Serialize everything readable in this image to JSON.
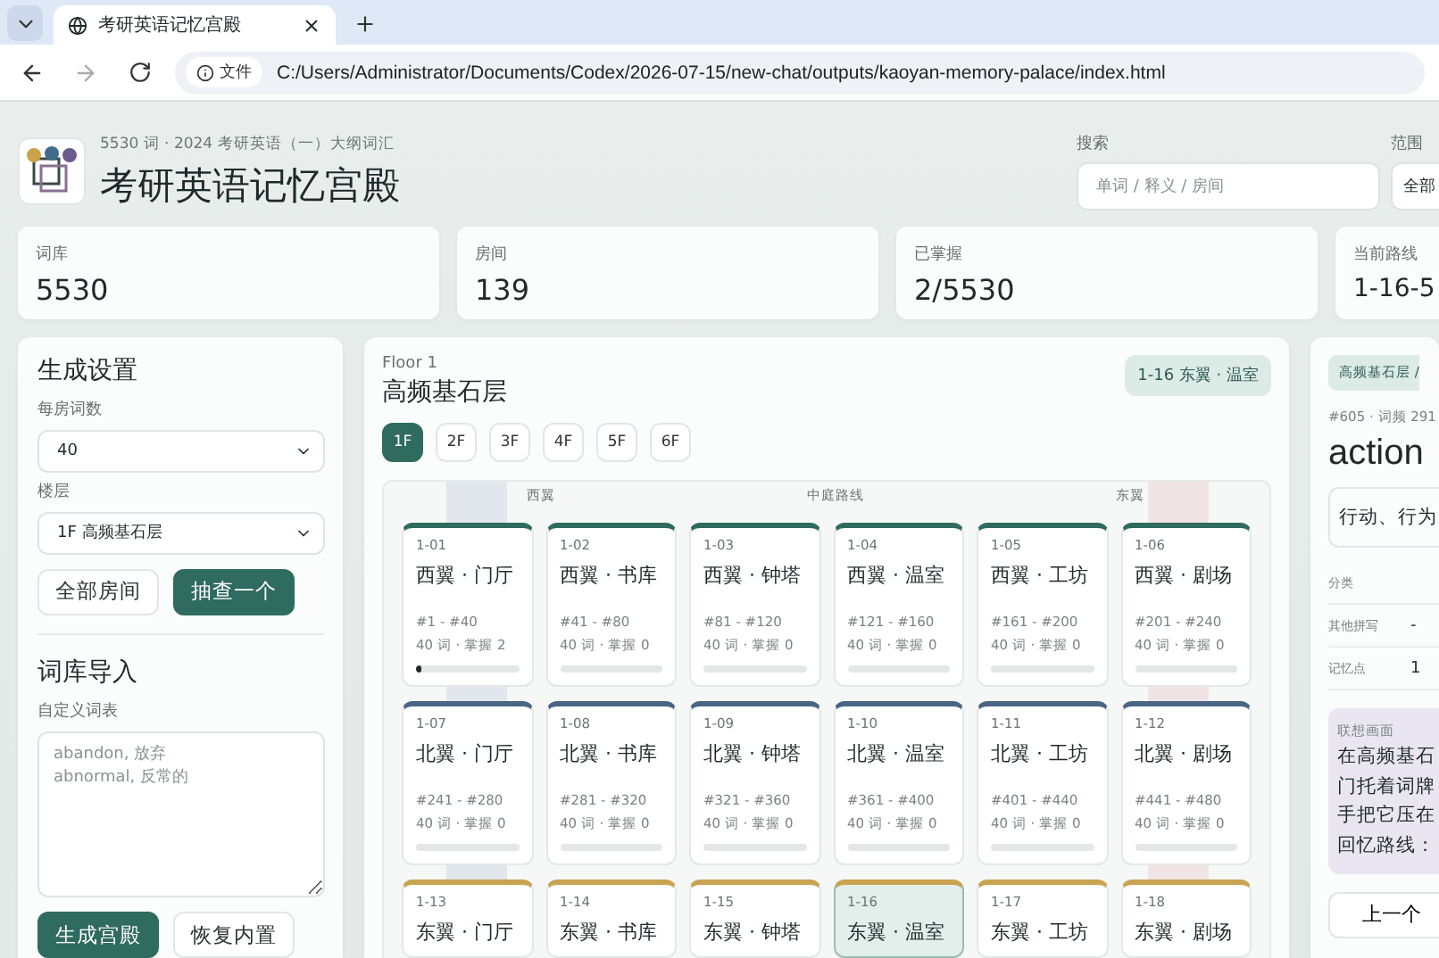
{
  "browser": {
    "tab_title": "考研英语记忆宫殿",
    "address_label": "文件",
    "url": "C:/Users/Administrator/Documents/Codex/2026-07-15/new-chat/outputs/kaoyan-memory-palace/index.html"
  },
  "header": {
    "subtitle": "5530 词 · 2024 考研英语（一）大纲词汇",
    "title": "考研英语记忆宫殿",
    "search": {
      "label": "搜索",
      "placeholder": "单词 / 释义 / 房间"
    },
    "scope": {
      "label": "范围",
      "value": "全部"
    }
  },
  "stats": [
    {
      "label": "词库",
      "value": "5530"
    },
    {
      "label": "房间",
      "value": "139"
    },
    {
      "label": "已掌握",
      "value": "2/5530"
    },
    {
      "label": "当前路线",
      "value": "1-16-5"
    }
  ],
  "settings": {
    "title": "生成设置",
    "per_room": {
      "label": "每房词数",
      "value": "40"
    },
    "floor_select": {
      "label": "楼层",
      "value": "1F 高频基石层"
    },
    "buttons": [
      {
        "label": "全部房间",
        "primary": false
      },
      {
        "label": "抽查一个",
        "primary": true
      }
    ],
    "import_title": "词库导入",
    "import_label": "自定义词表",
    "import_placeholder": "abandon, 放弃\nabnormal, 反常的",
    "import_buttons": [
      {
        "label": "生成宫殿",
        "primary": true
      },
      {
        "label": "恢复内置",
        "primary": false
      }
    ]
  },
  "floor": {
    "eyebrow": "Floor 1",
    "title": "高频基石层",
    "badge": "1-16 东翼 · 温室",
    "tabs": [
      {
        "label": "1F",
        "selected": true
      },
      {
        "label": "2F",
        "selected": false
      },
      {
        "label": "3F",
        "selected": false
      },
      {
        "label": "4F",
        "selected": false
      },
      {
        "label": "5F",
        "selected": false
      },
      {
        "label": "6F",
        "selected": false
      }
    ],
    "corridor": {
      "west": "西翼",
      "center": "中庭路线",
      "east": "东翼"
    },
    "rows": [
      {
        "color": "#2f6b5f",
        "rooms": [
          {
            "code": "1-01",
            "name": "西翼 · 门厅",
            "range": "#1 - #40",
            "count": "40 词 · 掌握 2",
            "level": 0.05,
            "selected": false
          },
          {
            "code": "1-02",
            "name": "西翼 · 书库",
            "range": "#41 - #80",
            "count": "40 词 · 掌握 0",
            "selected": false
          },
          {
            "code": "1-03",
            "name": "西翼 · 钟塔",
            "range": "#81 - #120",
            "count": "40 词 · 掌握 0",
            "selected": false
          },
          {
            "code": "1-04",
            "name": "西翼 · 温室",
            "range": "#121 - #160",
            "count": "40 词 · 掌握 0",
            "selected": false
          },
          {
            "code": "1-05",
            "name": "西翼 · 工坊",
            "range": "#161 - #200",
            "count": "40 词 · 掌握 0",
            "selected": false
          },
          {
            "code": "1-06",
            "name": "西翼 · 剧场",
            "range": "#201 - #240",
            "count": "40 词 · 掌握 0",
            "selected": false
          }
        ]
      },
      {
        "color": "#4a6684",
        "rooms": [
          {
            "code": "1-07",
            "name": "北翼 · 门厅",
            "range": "#241 - #280",
            "count": "40 词 · 掌握 0",
            "selected": false
          },
          {
            "code": "1-08",
            "name": "北翼 · 书库",
            "range": "#281 - #320",
            "count": "40 词 · 掌握 0",
            "selected": false
          },
          {
            "code": "1-09",
            "name": "北翼 · 钟塔",
            "range": "#321 - #360",
            "count": "40 词 · 掌握 0",
            "selected": false
          },
          {
            "code": "1-10",
            "name": "北翼 · 温室",
            "range": "#361 - #400",
            "count": "40 词 · 掌握 0",
            "selected": false
          },
          {
            "code": "1-11",
            "name": "北翼 · 工坊",
            "range": "#401 - #440",
            "count": "40 词 · 掌握 0",
            "selected": false
          },
          {
            "code": "1-12",
            "name": "北翼 · 剧场",
            "range": "#441 - #480",
            "count": "40 词 · 掌握 0",
            "selected": false
          }
        ]
      },
      {
        "color": "#c8a350",
        "rooms": [
          {
            "code": "1-13",
            "name": "东翼 · 门厅",
            "selected": false
          },
          {
            "code": "1-14",
            "name": "东翼 · 书库",
            "selected": false
          },
          {
            "code": "1-15",
            "name": "东翼 · 钟塔",
            "selected": false
          },
          {
            "code": "1-16",
            "name": "东翼 · 温室",
            "selected": true
          },
          {
            "code": "1-17",
            "name": "东翼 · 工坊",
            "selected": false
          },
          {
            "code": "1-18",
            "name": "东翼 · 剧场",
            "selected": false
          }
        ]
      }
    ]
  },
  "detail": {
    "breadcrumb": "高频基石层 /",
    "meta": "#605 · 词频 291",
    "word": "action",
    "meaning": "行动、行为",
    "fields": [
      {
        "label": "分类"
      },
      {
        "label": "其他拼写",
        "value": "-"
      },
      {
        "label": "记忆点",
        "value": "1"
      }
    ],
    "scene": {
      "label": "联想画面",
      "lines": [
        "在高频基石",
        "门托着词牌",
        "手把它压在",
        "回忆路线："
      ]
    },
    "button": "上一个"
  }
}
